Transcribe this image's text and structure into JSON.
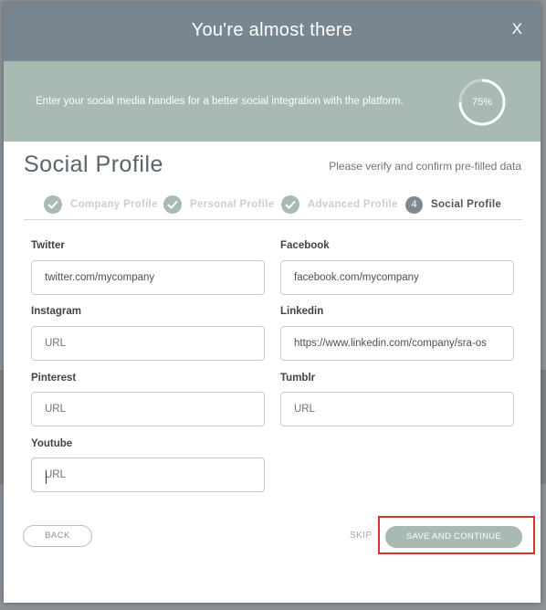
{
  "header": {
    "title": "You're almost there",
    "close_label": "X"
  },
  "banner": {
    "message": "Enter your social media handles for a better social integration with the platform.",
    "progress_value": 0.75,
    "progress_label": "75%"
  },
  "section": {
    "title": "Social Profile",
    "note": "Please verify and confirm pre-filled data"
  },
  "steps": [
    {
      "label": "Company Profile",
      "status": "complete"
    },
    {
      "label": "Personal Profile",
      "status": "complete"
    },
    {
      "label": "Advanced Profile",
      "status": "complete"
    },
    {
      "label": "Social Profile",
      "status": "active",
      "number": "4"
    }
  ],
  "fields": {
    "twitter": {
      "label": "Twitter",
      "value": "twitter.com/mycompany",
      "placeholder": "URL"
    },
    "facebook": {
      "label": "Facebook",
      "value": "facebook.com/mycompany",
      "placeholder": "URL"
    },
    "instagram": {
      "label": "Instagram",
      "value": "",
      "placeholder": "URL"
    },
    "linkedin": {
      "label": "Linkedin",
      "value": "https://www.linkedin.com/company/sra-os",
      "placeholder": "URL"
    },
    "pinterest": {
      "label": "Pinterest",
      "value": "",
      "placeholder": "URL"
    },
    "tumblr": {
      "label": "Tumblr",
      "value": "",
      "placeholder": "URL"
    },
    "youtube": {
      "label": "Youtube",
      "value": "",
      "placeholder": "URL"
    }
  },
  "footer": {
    "back_label": "BACK",
    "skip_label": "SKIP",
    "save_label": "SAVE AND CONTINUE"
  },
  "colors": {
    "header": "#79858f",
    "accent": "#a9bab3",
    "highlight": "#d9322f"
  }
}
